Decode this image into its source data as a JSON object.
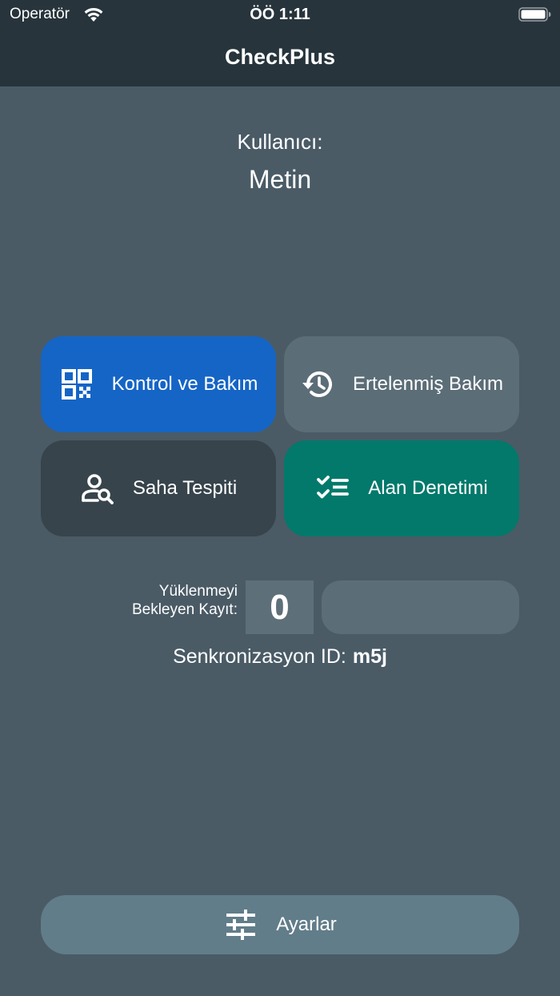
{
  "status_bar": {
    "carrier": "Operatör",
    "time": "ÖÖ 1:11"
  },
  "header": {
    "title": "CheckPlus"
  },
  "user": {
    "label": "Kullanıcı:",
    "name": "Metin"
  },
  "tiles": [
    {
      "label": "Kontrol ve Bakım",
      "icon": "qr-code-icon",
      "color": "#1565c6"
    },
    {
      "label": "Ertelenmiş Bakım",
      "icon": "history-icon",
      "color": "#5b6d77"
    },
    {
      "label": "Saha Tespiti",
      "icon": "person-search-icon",
      "color": "#37444c"
    },
    {
      "label": "Alan Denetimi",
      "icon": "checklist-icon",
      "color": "#02796b"
    }
  ],
  "pending": {
    "label_line1": "Yüklenmeyi",
    "label_line2": "Bekleyen Kayıt:",
    "count": "0"
  },
  "sync": {
    "label": "Senkronizasyon ID:",
    "id": "m5j"
  },
  "settings": {
    "label": "Ayarlar",
    "icon": "tune-icon"
  },
  "colors": {
    "background": "#4a5b66",
    "header": "#27343c",
    "settings_button": "#617d89"
  }
}
